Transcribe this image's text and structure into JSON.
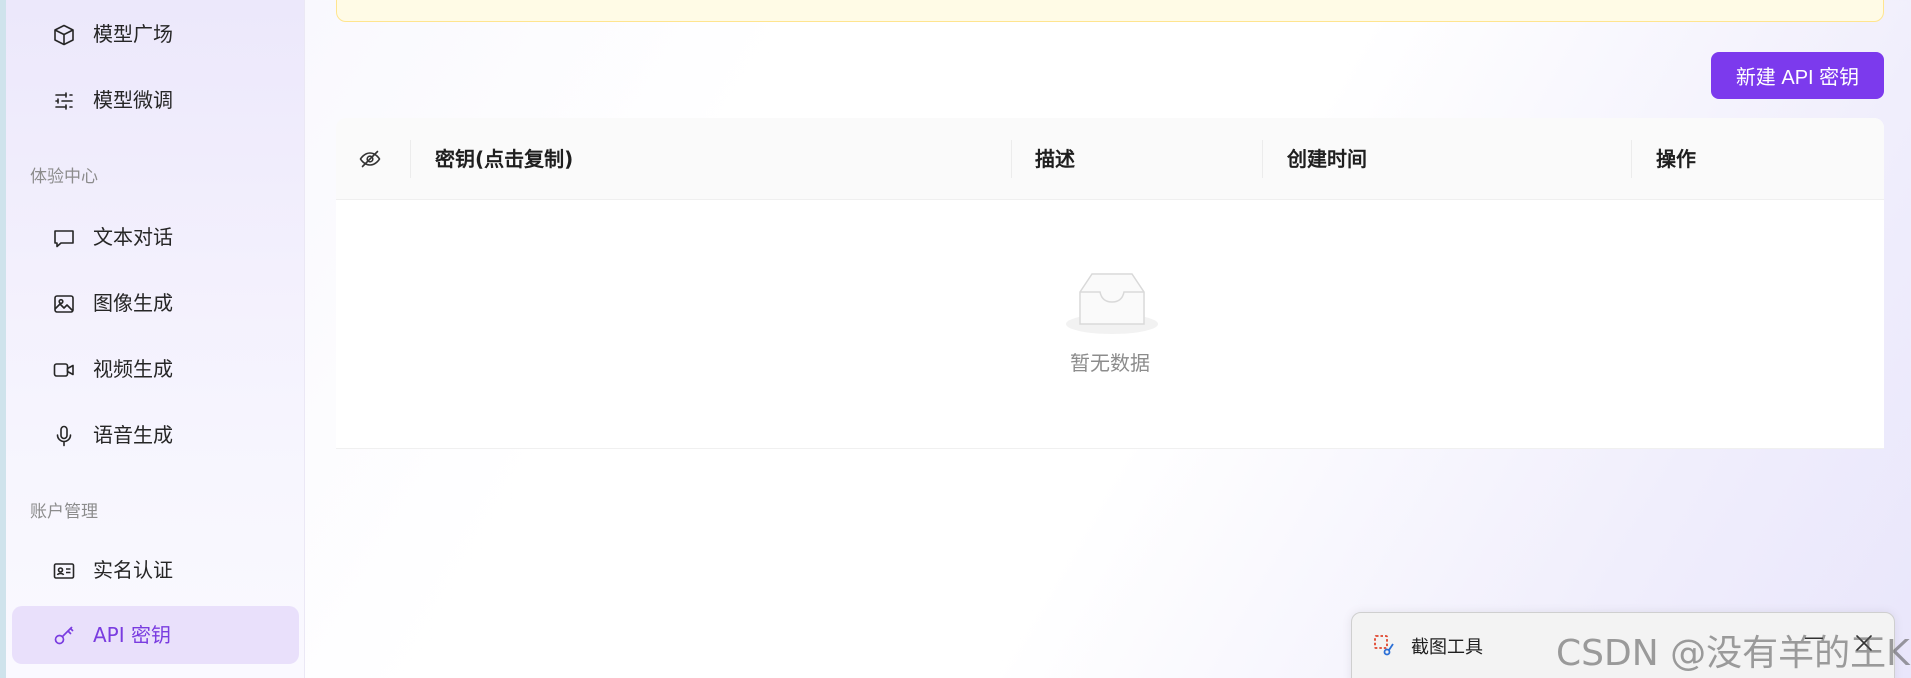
{
  "sidebar": {
    "items_top": [
      {
        "label": "模型广场",
        "icon": "cube-icon"
      },
      {
        "label": "模型微调",
        "icon": "sliders-icon"
      }
    ],
    "section_experience": "体验中心",
    "items_experience": [
      {
        "label": "文本对话",
        "icon": "chat-icon"
      },
      {
        "label": "图像生成",
        "icon": "image-icon"
      },
      {
        "label": "视频生成",
        "icon": "video-icon"
      },
      {
        "label": "语音生成",
        "icon": "microphone-icon"
      }
    ],
    "section_account": "账户管理",
    "items_account": [
      {
        "label": "实名认证",
        "icon": "id-card-icon"
      },
      {
        "label": "API 密钥",
        "icon": "key-icon",
        "active": true
      }
    ]
  },
  "main": {
    "new_key_button": "新建 API 密钥",
    "table": {
      "columns": [
        "密钥(点击复制)",
        "描述",
        "创建时间",
        "操作"
      ],
      "rows": [],
      "empty_text": "暂无数据"
    }
  },
  "snipping_tool": {
    "title": "截图工具",
    "minimize": "—"
  },
  "watermark": "CSDN @没有羊的王K",
  "colors": {
    "accent": "#7c3aed",
    "active_bg": "#e9e0fb",
    "notice_bg": "#fffbe6"
  }
}
